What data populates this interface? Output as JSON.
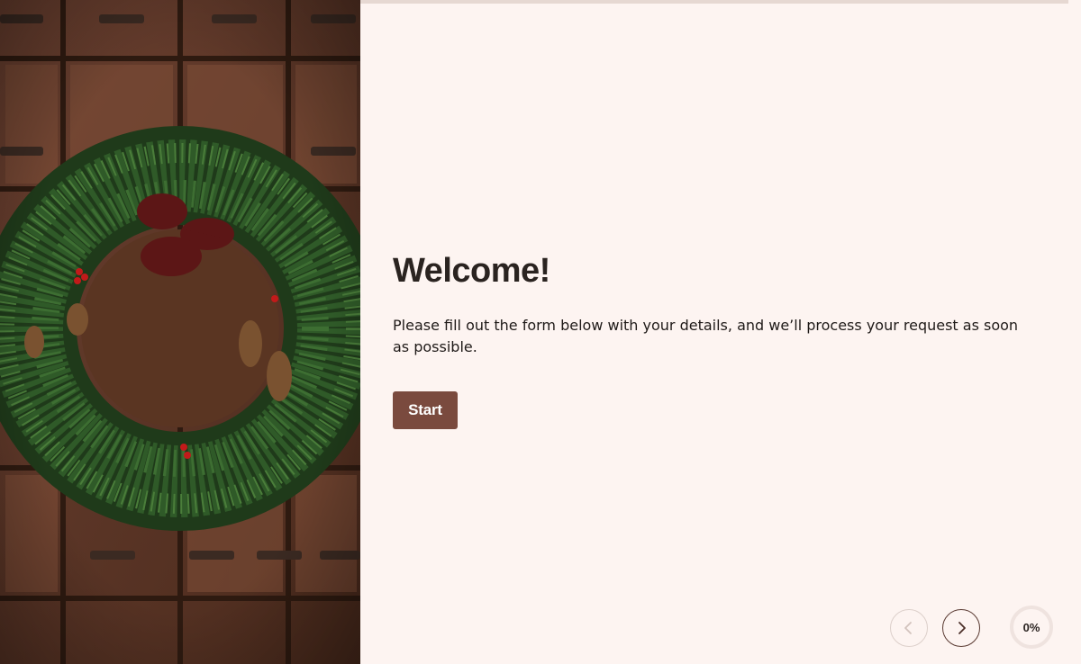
{
  "welcome": {
    "title": "Welcome!",
    "description": "Please fill out the form below with your details, and we’ll process your request as soon as possible.",
    "start_label": "Start"
  },
  "navigation": {
    "prev_icon": "chevron-left-icon",
    "next_icon": "chevron-right-icon",
    "progress_label": "0%",
    "progress_fraction": 0
  },
  "image": {
    "subject": "wreath-photo"
  },
  "colors": {
    "accent": "#7a4a3e",
    "background": "#fdf4f1",
    "text": "#2a2320"
  }
}
